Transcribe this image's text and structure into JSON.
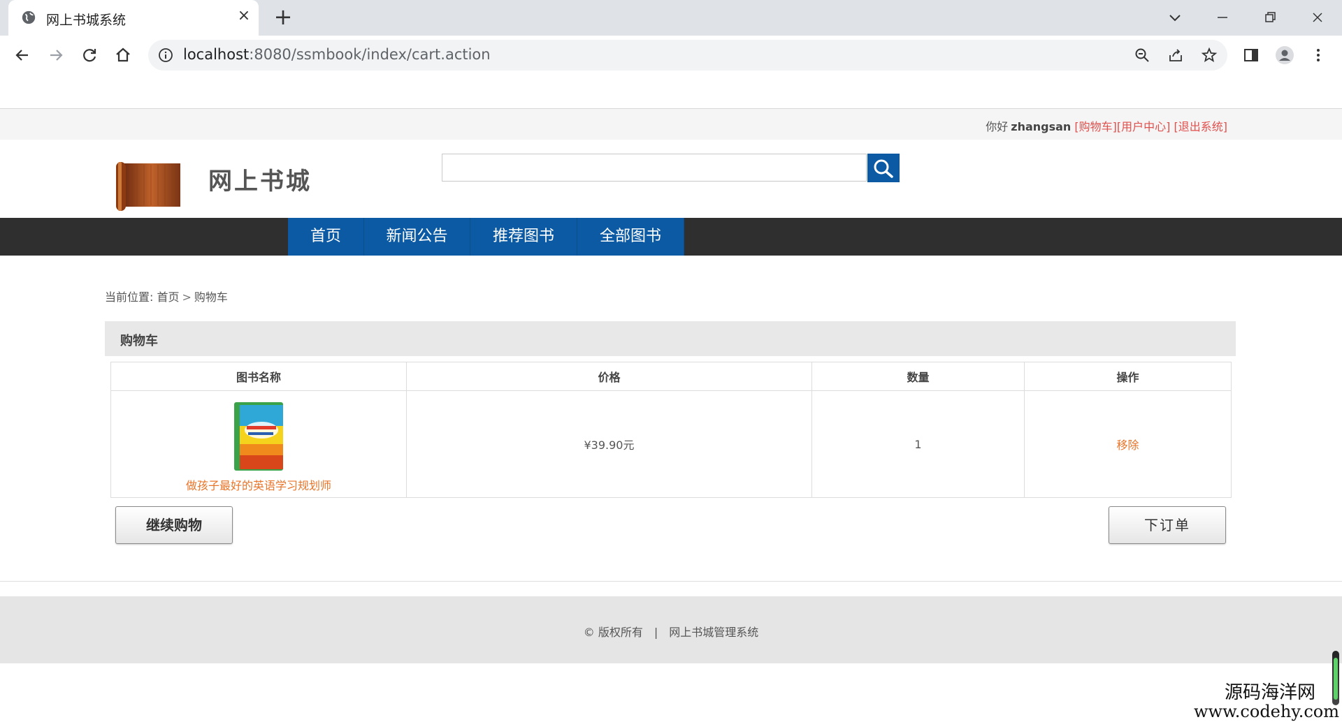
{
  "browser": {
    "tab_title": "网上书城系统",
    "url_host": "localhost",
    "url_rest": ":8080/ssmbook/index/cart.action"
  },
  "topbar": {
    "greeting": "你好",
    "username": "zhangsan",
    "cart_link": "[购物车]",
    "user_center_link": "[用户中心]",
    "logout_link": "[退出系统]"
  },
  "header": {
    "site_title": "网上书城",
    "search_placeholder": ""
  },
  "nav": {
    "items": [
      "首页",
      "新闻公告",
      "推荐图书",
      "全部图书"
    ]
  },
  "breadcrumb": {
    "prefix": "当前位置:",
    "home": "首页",
    "sep": ">",
    "current": "购物车"
  },
  "cart": {
    "title": "购物车",
    "columns": [
      "图书名称",
      "价格",
      "数量",
      "操作"
    ],
    "rows": [
      {
        "name": "做孩子最好的英语学习规划师",
        "price": "¥39.90元",
        "quantity": "1",
        "action": "移除"
      }
    ]
  },
  "buttons": {
    "continue": "继续购物",
    "order": "下订单"
  },
  "footer": {
    "copyright": "© 版权所有",
    "divider": "|",
    "system_name": "网上书城管理系统"
  },
  "watermark": {
    "line1": "源码海洋网",
    "line2": "www.codehy.com"
  },
  "colors": {
    "nav_blue": "#0b5aa3",
    "link_orange": "#e8752a",
    "link_red": "#e0504d"
  }
}
